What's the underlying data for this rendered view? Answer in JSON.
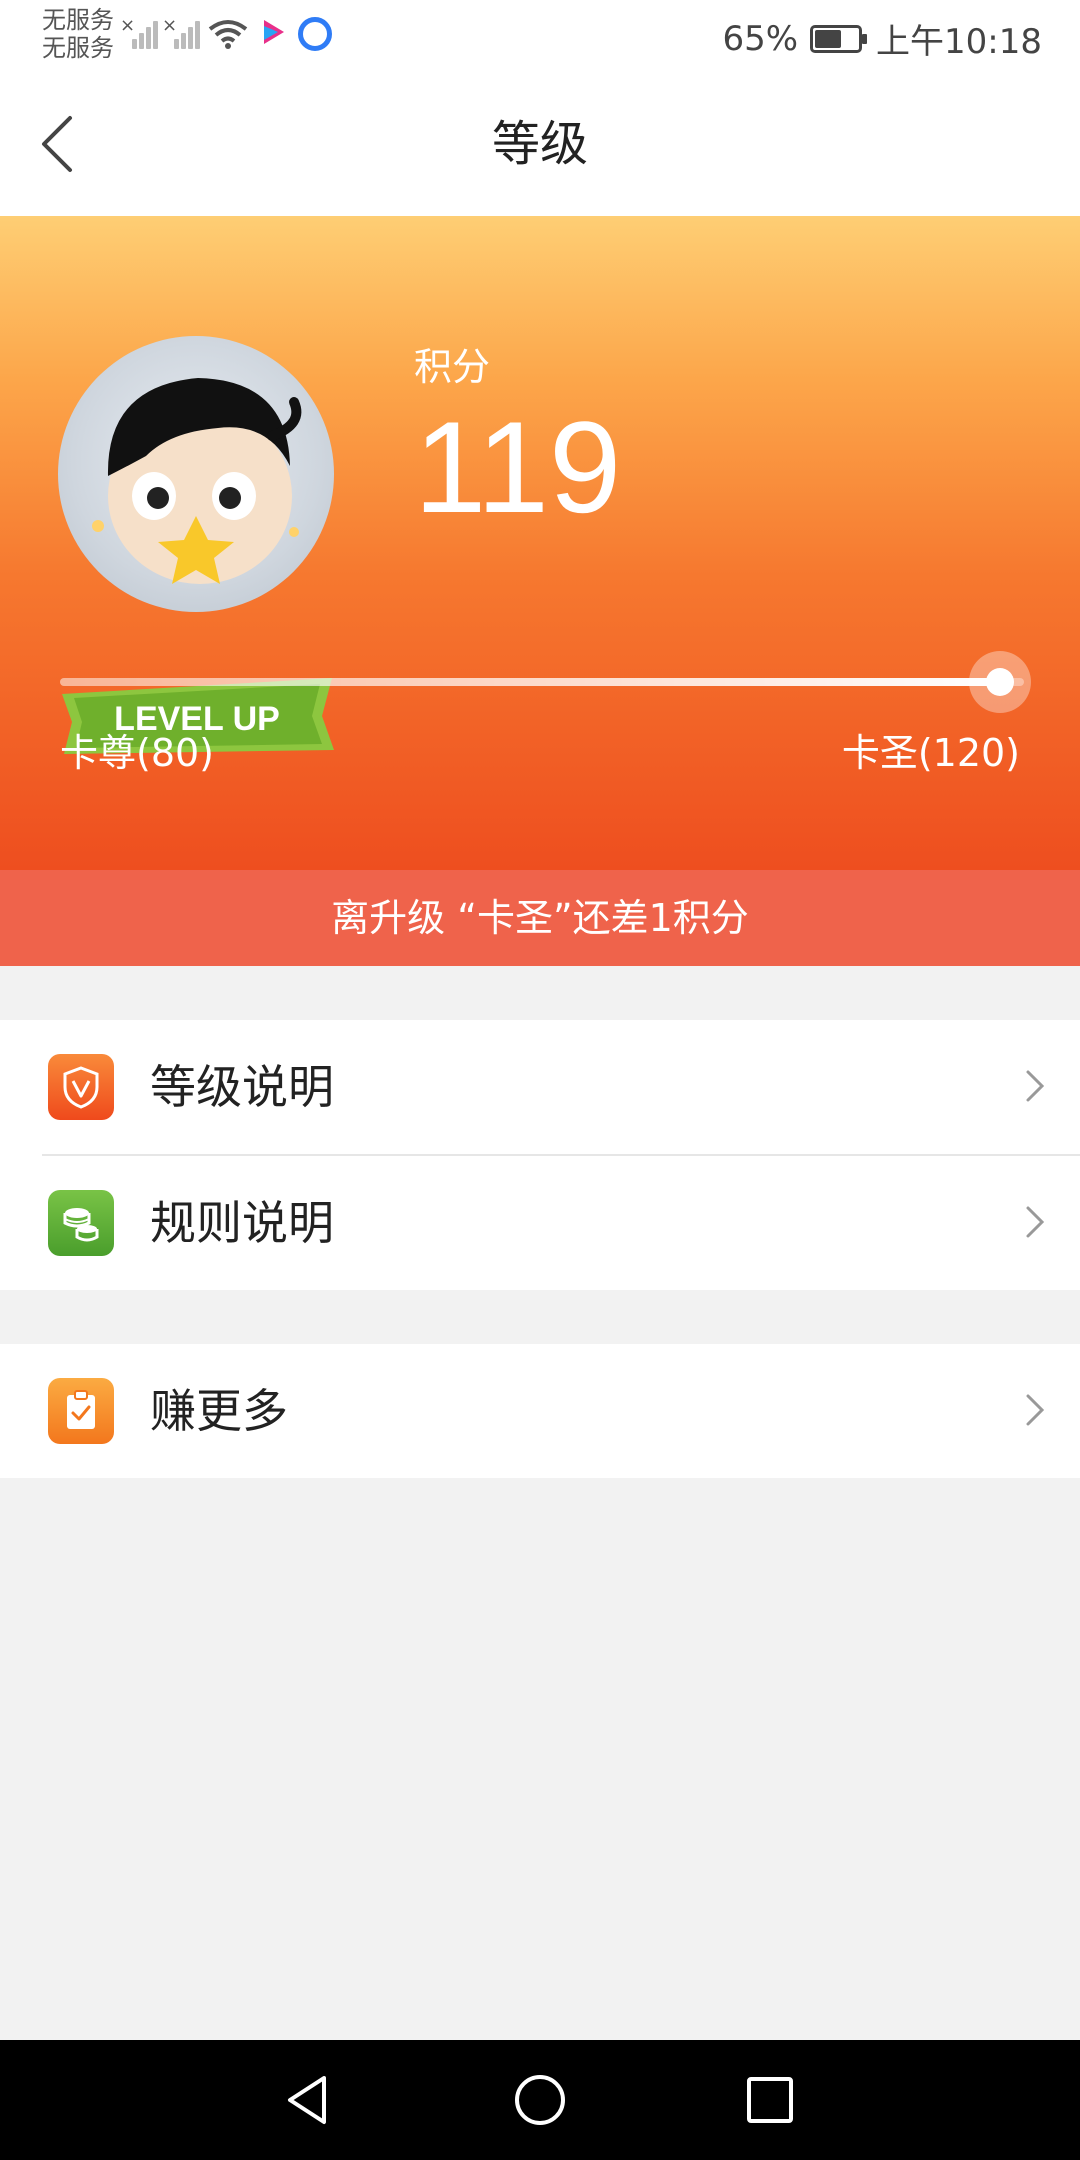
{
  "status_bar": {
    "carrier_1": "无服务",
    "carrier_2": "无服务",
    "battery_percent": "65%",
    "battery_level": 0.65,
    "time": "上午10:18",
    "app_icon_1": "youku-icon",
    "app_icon_2": "app-q-icon"
  },
  "header": {
    "title": "等级",
    "back_icon": "chevron-left-icon"
  },
  "hero": {
    "avatar_badge": "LEVEL UP",
    "score_label": "积分",
    "score_value": "119",
    "level_from": "卡尊(80)",
    "level_to": "卡圣(120)",
    "progress_fraction": 0.975,
    "gradient_top": "#fece74",
    "gradient_bottom": "#ee4e1f"
  },
  "notice": {
    "text": "离升级 “卡圣”还差1积分",
    "background": "#ef634b"
  },
  "menu": {
    "group1": [
      {
        "label": "等级说明",
        "icon": "shield-v-icon",
        "color": "#f25a22"
      },
      {
        "label": "规则说明",
        "icon": "coins-icon",
        "color": "#5aae38"
      }
    ],
    "group2": [
      {
        "label": "赚更多",
        "icon": "clipboard-check-icon",
        "color": "#f48b22"
      }
    ]
  },
  "nav_bar": {
    "back": "triangle-back-icon",
    "home": "circle-home-icon",
    "recents": "square-recents-icon"
  }
}
